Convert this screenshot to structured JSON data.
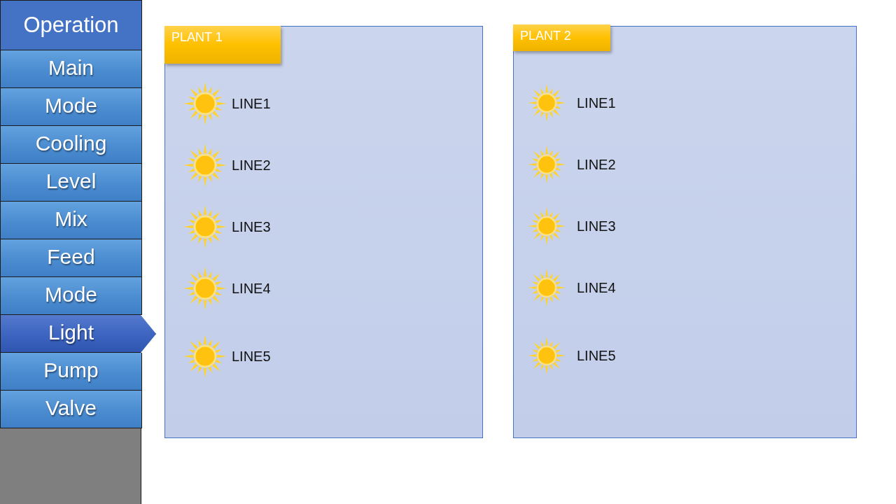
{
  "sidebar": {
    "title": "Operation",
    "items": [
      {
        "label": "Main",
        "selected": false
      },
      {
        "label": "Mode",
        "selected": false
      },
      {
        "label": "Cooling",
        "selected": false
      },
      {
        "label": "Level",
        "selected": false
      },
      {
        "label": "Mix",
        "selected": false
      },
      {
        "label": "Feed",
        "selected": false
      },
      {
        "label": "Mode",
        "selected": false
      },
      {
        "label": "Light",
        "selected": true
      },
      {
        "label": "Pump",
        "selected": false
      },
      {
        "label": "Valve",
        "selected": false
      }
    ]
  },
  "plants": [
    {
      "title": "PLANT 1",
      "lines": [
        "LINE1",
        "LINE2",
        "LINE3",
        "LINE4",
        "LINE5"
      ]
    },
    {
      "title": "PLANT 2",
      "lines": [
        "LINE1",
        "LINE2",
        "LINE3",
        "LINE4",
        "LINE5"
      ]
    }
  ]
}
